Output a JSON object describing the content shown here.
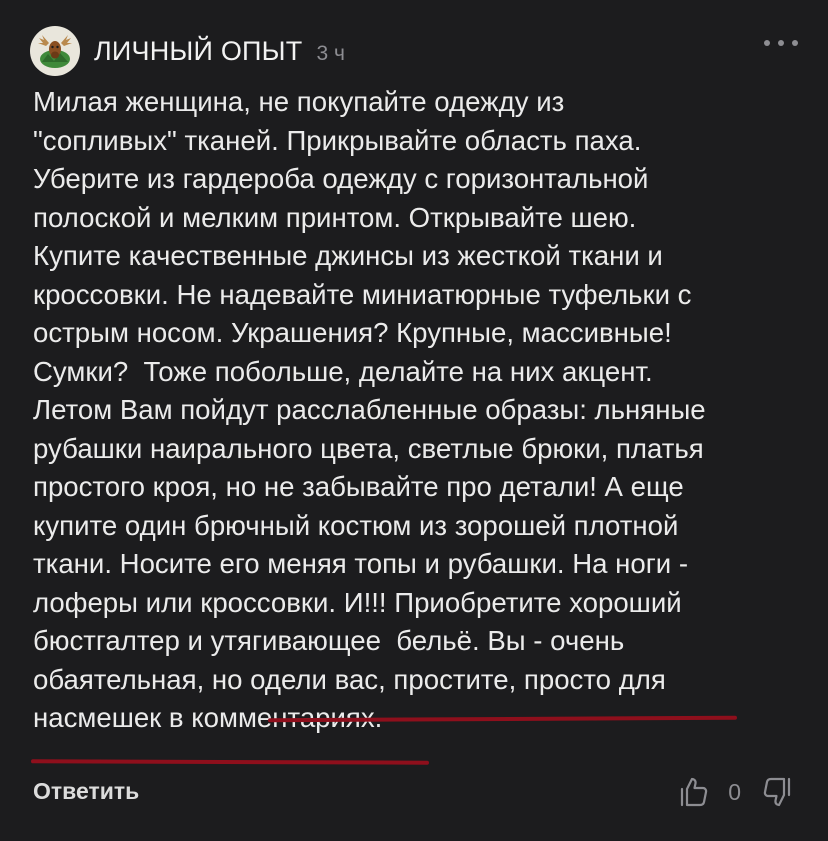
{
  "comment": {
    "author": "ЛИЧНЫЙ ОПЫТ",
    "time": "3 ч",
    "lines": [
      "Милая женщина, не покупайте одежду из",
      "\"сопливых\" тканей. Прикрывайте область паха.",
      "Уберите из гардероба одежду с горизонтальной",
      "полоской и мелким принтом. Открывайте шею.",
      "Купите качественные джинсы из жесткой ткани и",
      "кроссовки. Не надевайте миниатюрные туфельки с",
      "острым носом. Украшения? Крупные, массивные!",
      "Сумки?  Тоже побольше, делайте на них акцент.",
      "Летом Вам пойдут расслабленные образы: льняные",
      "рубашки наирального цвета, светлые брюки, платья",
      "простого кроя, но не забывайте про детали! А еще",
      "купите один брючный костюм из зорошей плотной",
      "ткани. Носите его меняя топы и рубашки. На ноги -",
      "лоферы или кроссовки. И!!! Приобретите хороший",
      "бюстгалтер и утягивающее  бельё. Вы - очень",
      "обаятельная, но одели вас, простите, просто для",
      "насмешек в комментариях."
    ],
    "reply_label": "Ответить",
    "vote_count": "0"
  },
  "icons": {
    "avatar": "moose-avatar-icon",
    "more": "more-dots-icon",
    "like": "thumbs-up-icon",
    "dislike": "thumbs-down-icon"
  },
  "colors": {
    "background": "#1c1c1e",
    "text": "#ebebeb",
    "muted": "#8d8d92",
    "underline": "#8e0f1c"
  }
}
